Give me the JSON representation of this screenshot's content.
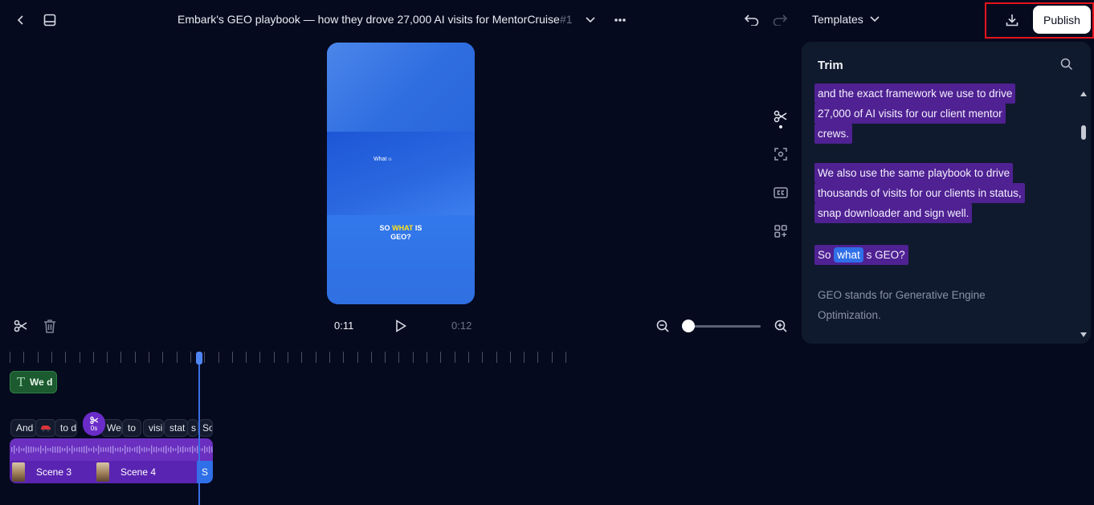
{
  "header": {
    "title": "Embark's GEO playbook — how they drove 27,000 AI visits for MentorCruise",
    "title_number": "#1",
    "templates_label": "Templates",
    "publish_label": "Publish"
  },
  "preview": {
    "small_text": "What",
    "small_text_suffix": "is",
    "caption_pre": "SO",
    "caption_highlight": "WHAT",
    "caption_post": "IS",
    "caption_line2": "GEO?"
  },
  "playback": {
    "current_time": "0:11",
    "total_time": "0:12"
  },
  "panel": {
    "title": "Trim",
    "paragraph1": [
      "and the exact framework we use to drive",
      "27,000 of AI visits for our client mentor",
      "crews."
    ],
    "paragraph2": [
      "We also use the same playbook to drive",
      "thousands of visits for our clients in status,",
      "snap downloader and sign well."
    ],
    "paragraph3_pre": "So",
    "paragraph3_highlight": "what",
    "paragraph3_post": "s GEO?",
    "paragraph4": [
      "GEO stands for Generative Engine",
      "Optimization."
    ]
  },
  "timeline": {
    "text_clip_label": "We d",
    "words": [
      "And",
      "to d",
      "We",
      "to",
      "visi",
      "stat",
      "s",
      "So"
    ],
    "split_label": "0s",
    "scenes": [
      "Scene 3",
      "Scene 4",
      "S"
    ]
  },
  "colors": {
    "background": "#060a1e",
    "panel": "#101a2e",
    "highlight_purple": "#4f2192",
    "accent_blue": "#2f6fe8",
    "publish_outline": "#e3141b"
  }
}
